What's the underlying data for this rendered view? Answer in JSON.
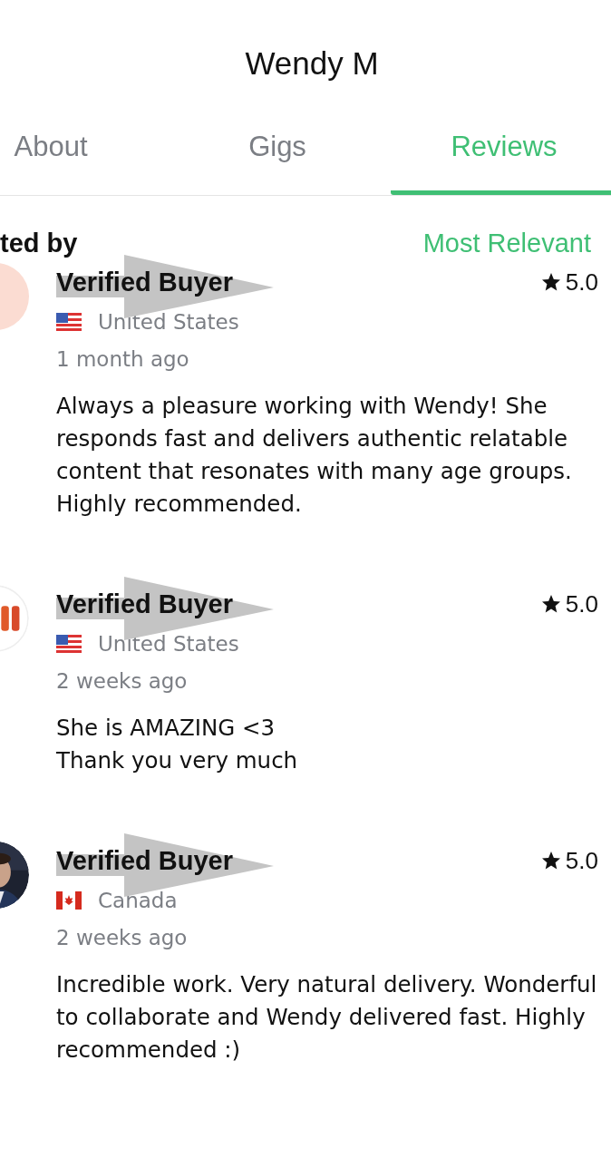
{
  "header": {
    "title": "Wendy M"
  },
  "tabs": [
    {
      "label": "About",
      "selected": false
    },
    {
      "label": "Gigs",
      "selected": false
    },
    {
      "label": "Reviews",
      "selected": true
    }
  ],
  "sort": {
    "label": "ted by",
    "value": "Most Relevant"
  },
  "reviews": [
    {
      "avatar": {
        "kind": "peach"
      },
      "name": "Verified Buyer",
      "flag": {
        "kind": "us"
      },
      "country": "United States",
      "time": "1 month ago",
      "rating": "5.0",
      "text": "Always a pleasure working with Wendy! She responds fast and delivers authentic relatable content that resonates with many age groups. Highly recommended."
    },
    {
      "avatar": {
        "kind": "logo"
      },
      "name": "Verified Buyer",
      "flag": {
        "kind": "us"
      },
      "country": "United States",
      "time": "2 weeks ago",
      "rating": "5.0",
      "text": "She is AMAZING <3\nThank you very much"
    },
    {
      "name": "Verified Buyer",
      "flag": {
        "kind": "ca"
      },
      "country": "Canada",
      "time": "2 weeks ago",
      "rating": "5.0",
      "text": "Incredible work. Very natural delivery. Wonderful to collaborate and Wendy delivered fast. Highly recommended :)"
    }
  ]
}
